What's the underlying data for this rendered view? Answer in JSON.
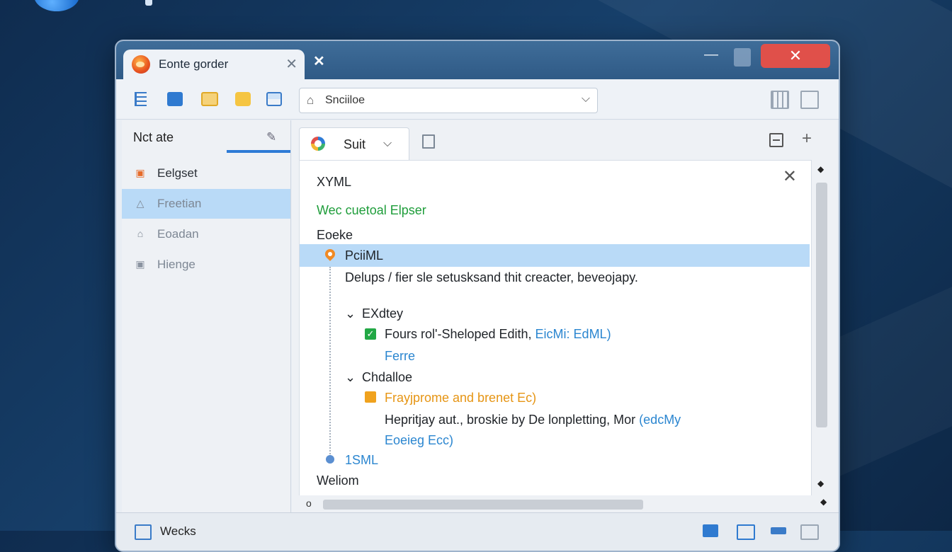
{
  "desktop": {
    "top_label": "p"
  },
  "window": {
    "tab_title": "Eonte gorder",
    "tab_close_glyph": "✕",
    "new_tab_glyph": "✕",
    "min_glyph": "—",
    "close_glyph": "✕"
  },
  "toolbar": {
    "address_home_glyph": "⌂",
    "address_text": "Snciiloe",
    "address_chevron": "⌵",
    "icons": [
      "list-icon",
      "folder-icon",
      "grid-icon",
      "folder-yellow-icon",
      "inbox-icon",
      "layout-icon",
      "window-icon"
    ]
  },
  "sidebar": {
    "title": "Nct ate",
    "edit_glyph": "✎",
    "items": [
      {
        "label": "Eelgset",
        "icon": "image-icon",
        "glyph": "▣"
      },
      {
        "label": "Freetian",
        "icon": "triangle-icon",
        "glyph": "△"
      },
      {
        "label": "Eoadan",
        "icon": "home-icon",
        "glyph": "⌂"
      },
      {
        "label": "Hienge",
        "icon": "box-icon",
        "glyph": "▣"
      }
    ]
  },
  "content": {
    "tab_label": "Suit",
    "tab_chevron": "⌵",
    "plus_glyph": "+",
    "close_glyph": "✕",
    "lines": {
      "l1": "XYML",
      "l2": "Wec cuetoal  Elpser",
      "l3": "Eoeke",
      "l4": "PciiML",
      "l5": "Delups / fier sle setusksand thit creacter, beveojapy.",
      "l6_chev": "⌄",
      "l6": "EXdtey",
      "l7a": "Fours rol'-Sheloped Edith, ",
      "l7b": "EicMi: EdML)",
      "l8": "Ferre",
      "l9_chev": "⌄",
      "l9": "Chdalloe",
      "l10": "Frayjprome and brenet Ec)",
      "l11a": "Hepritjay aut., broskie  by De lonpletting, Mor ",
      "l11b": "(edcMy",
      "l12": "Eoeieg Ecc)",
      "l13": "1SML",
      "l14": "Weliom"
    },
    "scroll_glyphs": {
      "up": "◆",
      "down": "◆",
      "left": "o",
      "right": "◆"
    }
  },
  "statusbar": {
    "label": "Wecks"
  },
  "colors": {
    "accent": "#2e7bd6",
    "selection": "#b9daf7",
    "green_text": "#1e9d3a",
    "blue_text": "#2b86d0",
    "orange_text": "#e69514",
    "close_button": "#e0504a"
  }
}
